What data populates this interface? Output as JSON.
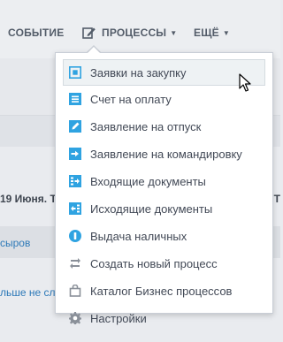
{
  "topnav": {
    "events": "СОБЫТИЕ",
    "processes": "ПРОЦЕССЫ",
    "more": "ЕЩЁ"
  },
  "background": {
    "date_text": "19 Июня. Т",
    "right_text_1": "",
    "link_text": "сыров",
    "more_text": "льше не сл"
  },
  "menu": {
    "items": [
      {
        "label": "Заявки на закупку",
        "icon": "square-icon",
        "hover": true
      },
      {
        "label": "Счет на оплату",
        "icon": "invoice-icon"
      },
      {
        "label": "Заявление на отпуск",
        "icon": "edit-icon"
      },
      {
        "label": "Заявление на командировку",
        "icon": "arrow-in-icon"
      },
      {
        "label": "Входящие документы",
        "icon": "documents-in-icon"
      },
      {
        "label": "Исходящие документы",
        "icon": "documents-out-icon"
      },
      {
        "label": "Выдача наличных",
        "icon": "cash-icon"
      },
      {
        "label": "Создать новый процесс",
        "icon": "cycle-icon"
      },
      {
        "label": "Каталог Бизнес процессов",
        "icon": "bag-icon"
      },
      {
        "label": "Настройки",
        "icon": "gear-icon"
      }
    ]
  },
  "colors": {
    "accent_blue": "#2fa3e1",
    "text_dark": "#424956",
    "muted_gray": "#8a9099"
  }
}
